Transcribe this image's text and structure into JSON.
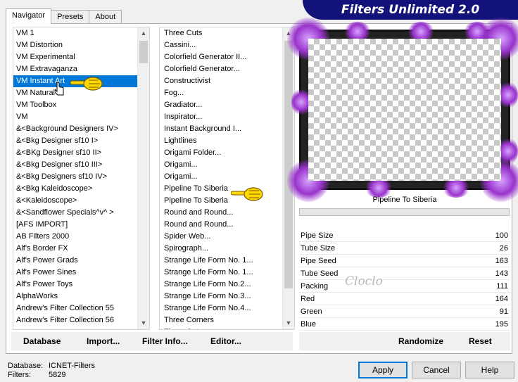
{
  "title_banner": "Filters Unlimited 2.0",
  "tabs": [
    {
      "label": "Navigator",
      "active": true
    },
    {
      "label": "Presets",
      "active": false
    },
    {
      "label": "About",
      "active": false
    }
  ],
  "categories": [
    "VM 1",
    "VM Distortion",
    "VM Experimental",
    "VM Extravaganza",
    "VM Instant Art",
    "VM Natural",
    "VM Toolbox",
    "VM",
    "&<Background Designers IV>",
    "&<Bkg Designer sf10 I>",
    "&<BKg Designer sf10 II>",
    "&<Bkg Designer sf10 III>",
    "&<Bkg Designers sf10 IV>",
    "&<Bkg Kaleidoscope>",
    "&<Kaleidoscope>",
    "&<Sandflower Specials^v^ >",
    "[AFS IMPORT]",
    "AB Filters 2000",
    "Alf's Border FX",
    "Alf's Power Grads",
    "Alf's Power Sines",
    "Alf's Power Toys",
    "AlphaWorks",
    "Andrew's Filter Collection 55",
    "Andrew's Filter Collection 56"
  ],
  "selected_category": "VM Instant Art",
  "filters": [
    "Three Cuts",
    "Cassini...",
    "Colorfield Generator II...",
    "Colorfield Generator...",
    "Constructivist",
    "Fog...",
    "Gradiator...",
    "Inspirator...",
    "Instant Background I...",
    "Lightlines",
    "Origami Folder...",
    "Origami...",
    "Origami...",
    "Pipeline To Siberia",
    "Pipeline To Siberia",
    "Round and Round...",
    "Round and Round...",
    "Spider Web...",
    "Spirograph...",
    "Strange Life Form No. 1...",
    "Strange Life Form No. 1...",
    "Strange Life Form No.2...",
    "Strange Life Form No.3...",
    "Strange Life Form No.4...",
    "Three Corners",
    "Three Cuts"
  ],
  "selected_filter_name": "Pipeline To Siberia",
  "parameters": [
    {
      "name": "Pipe Size",
      "value": "100"
    },
    {
      "name": "Tube Size",
      "value": "26"
    },
    {
      "name": "Pipe Seed",
      "value": "163"
    },
    {
      "name": "Tube Seed",
      "value": "143"
    },
    {
      "name": "Packing",
      "value": "111"
    },
    {
      "name": "Red",
      "value": "164"
    },
    {
      "name": "Green",
      "value": "91"
    },
    {
      "name": "Blue",
      "value": "195"
    }
  ],
  "watermark": "Cloclo",
  "toolbar": {
    "database": "Database",
    "import": "Import...",
    "filter_info": "Filter Info...",
    "editor": "Editor...",
    "randomize": "Randomize",
    "reset": "Reset"
  },
  "info": {
    "database_label": "Database:",
    "database_value": "ICNET-Filters",
    "filters_label": "Filters:",
    "filters_value": "5829"
  },
  "buttons": {
    "apply": "Apply",
    "cancel": "Cancel",
    "help": "Help"
  },
  "colors": {
    "banner": "#12127a",
    "selection": "#0078d7",
    "glow": "#9933cc"
  }
}
